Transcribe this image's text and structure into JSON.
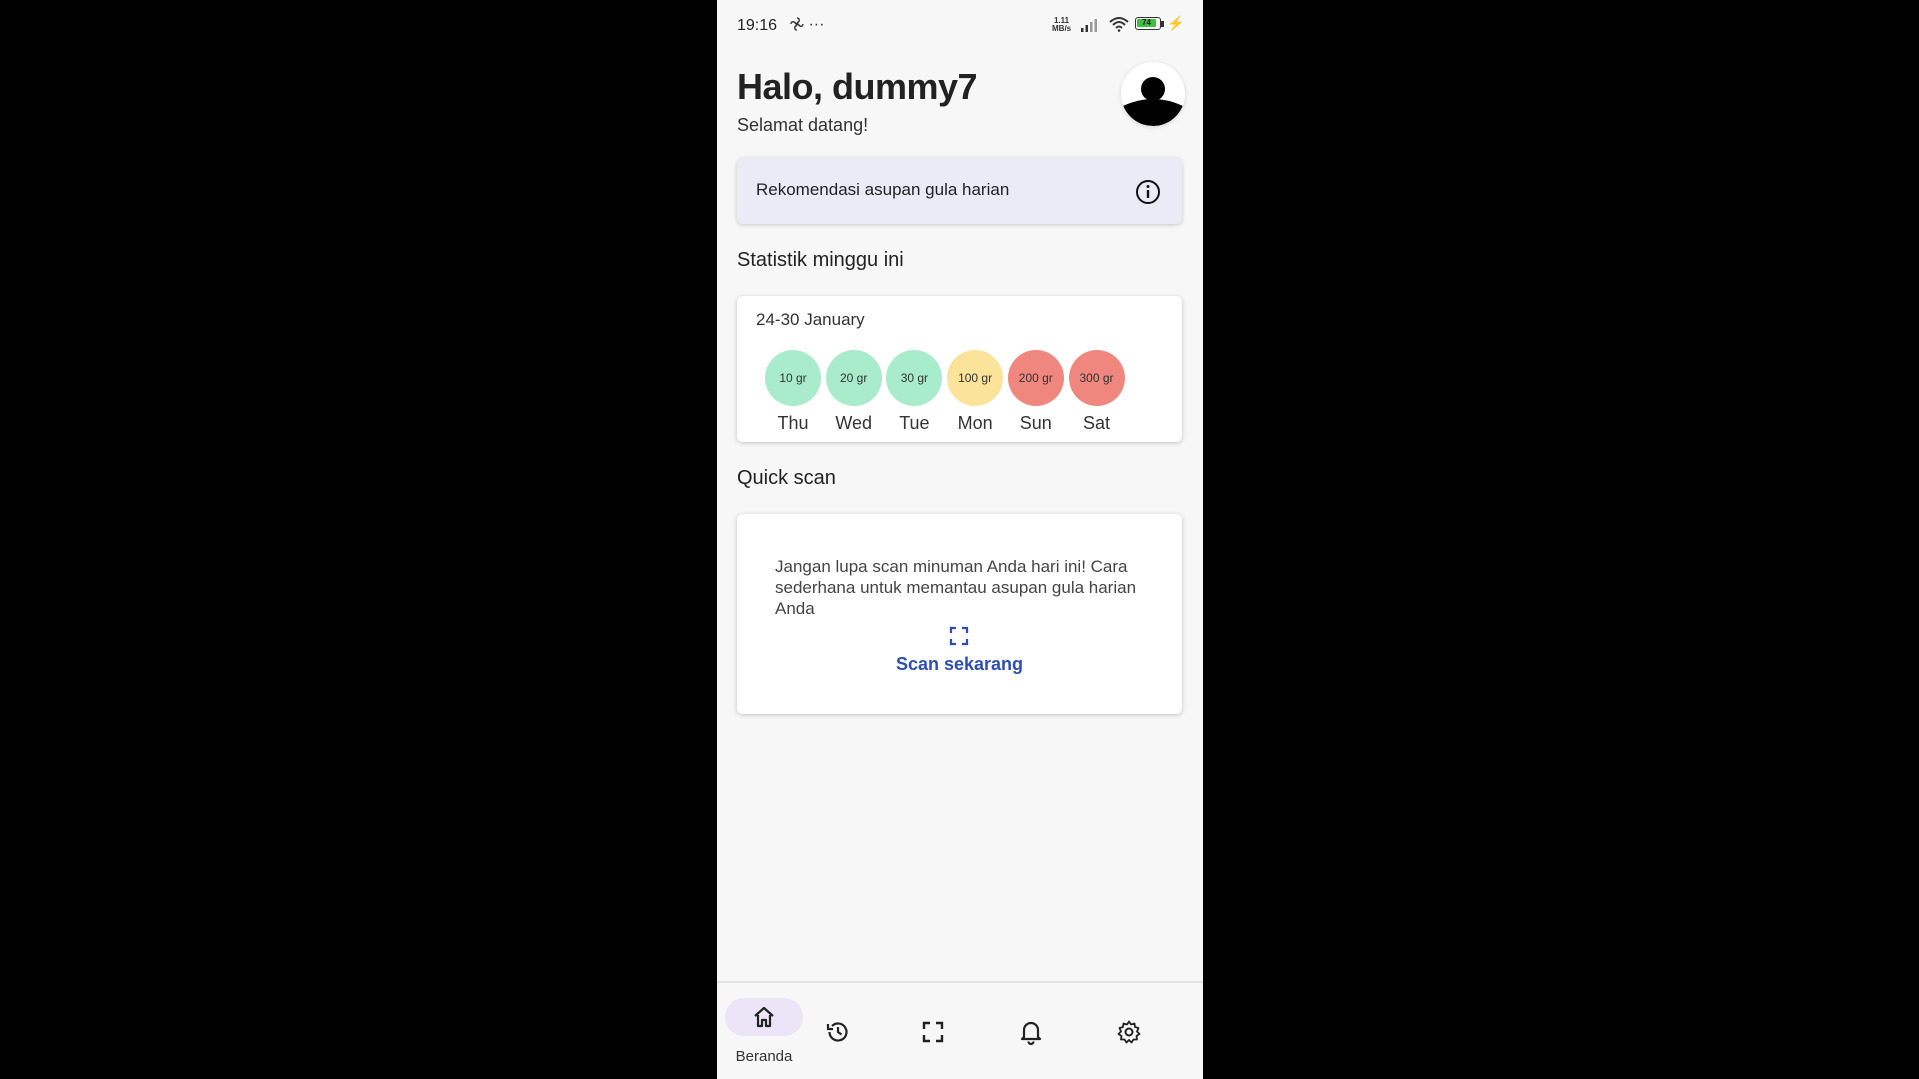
{
  "status_bar": {
    "time": "19:16",
    "extra": "···",
    "net_speed_value": "1.11",
    "net_speed_unit": "MB/s",
    "battery_level": "74"
  },
  "header": {
    "greeting": "Halo, dummy7",
    "subtitle": "Selamat datang!"
  },
  "recommendation": {
    "label": "Rekomendasi asupan gula harian"
  },
  "stats": {
    "section_title": "Statistik minggu ini",
    "date_range": "24-30 January",
    "days": [
      {
        "amount": "10 gr",
        "day": "Thu",
        "color": "#a8eccb"
      },
      {
        "amount": "20 gr",
        "day": "Wed",
        "color": "#a8eccb"
      },
      {
        "amount": "30 gr",
        "day": "Tue",
        "color": "#a8eccb"
      },
      {
        "amount": "100 gr",
        "day": "Mon",
        "color": "#fbe39a"
      },
      {
        "amount": "200 gr",
        "day": "Sun",
        "color": "#f0877e"
      },
      {
        "amount": "300 gr",
        "day": "Sat",
        "color": "#f0877e"
      }
    ]
  },
  "quick_scan": {
    "section_title": "Quick scan",
    "message": "Jangan lupa scan minuman Anda hari ini! Cara sederhana untuk memantau asupan gula harian Anda",
    "action_label": "Scan sekarang"
  },
  "bottom_nav": {
    "items": [
      {
        "icon": "home-icon",
        "label": "Beranda",
        "active": true
      },
      {
        "icon": "history-icon",
        "label": "",
        "active": false
      },
      {
        "icon": "scan-icon",
        "label": "",
        "active": false
      },
      {
        "icon": "bell-icon",
        "label": "",
        "active": false
      },
      {
        "icon": "gear-icon",
        "label": "",
        "active": false
      }
    ]
  },
  "colors": {
    "accent_link": "#2c4fb5",
    "card_highlight": "#ebebf8",
    "nav_active_pill": "#ece4f7"
  }
}
